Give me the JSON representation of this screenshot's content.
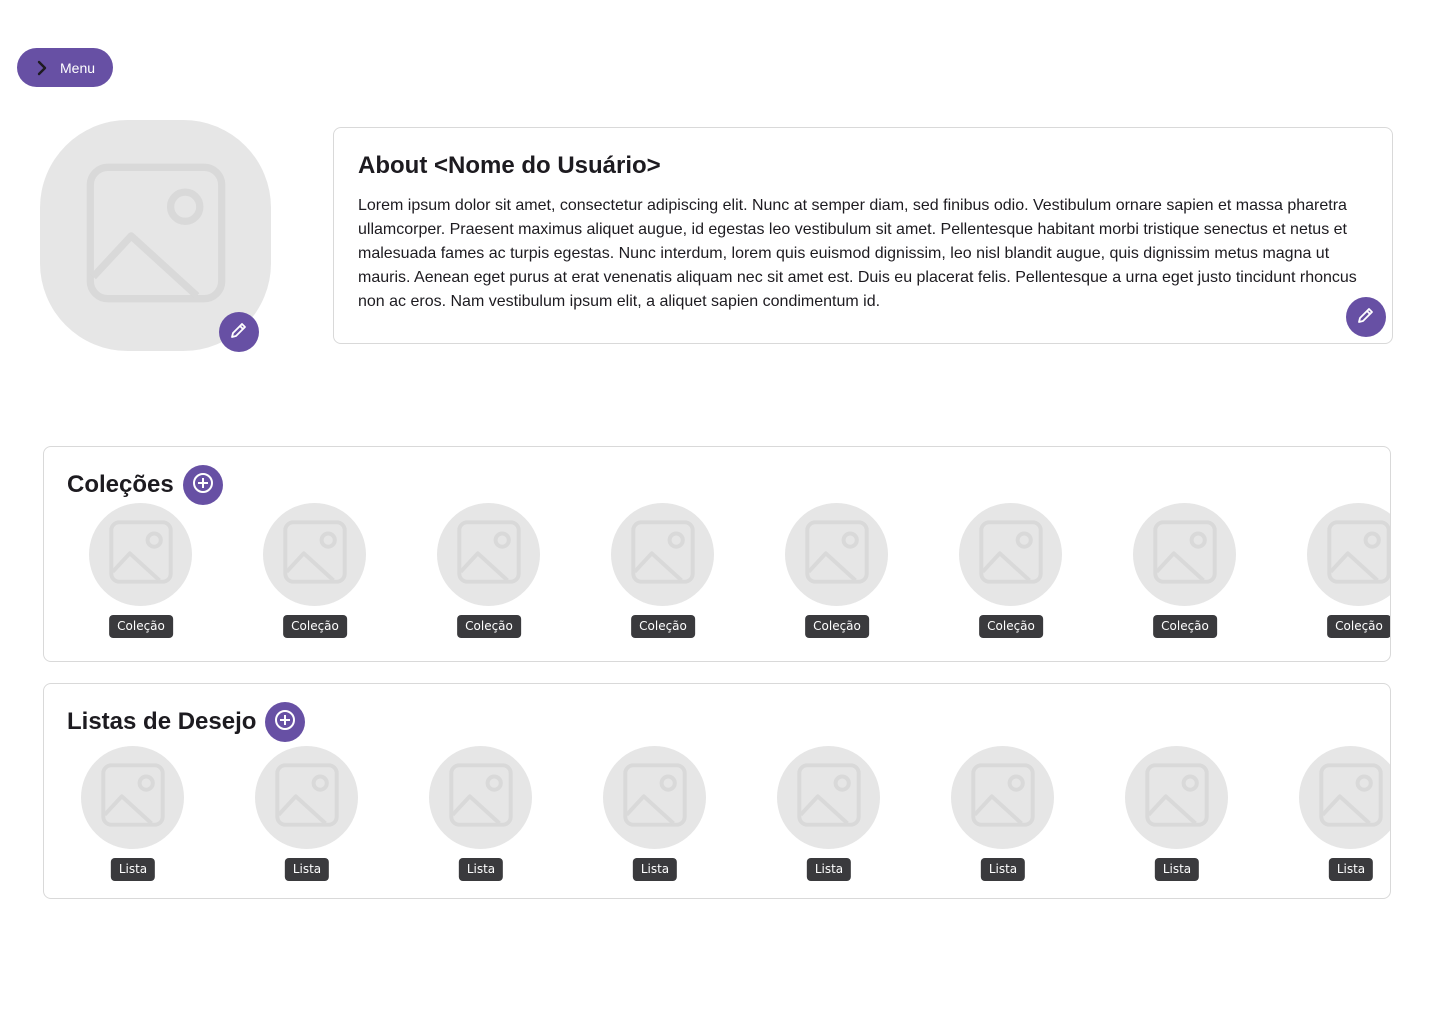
{
  "menu": {
    "label": "Menu"
  },
  "about": {
    "title": "About <Nome do Usuário>",
    "text": "Lorem ipsum dolor sit amet, consectetur adipiscing elit. Nunc at semper diam, sed finibus odio. Vestibulum ornare sapien et massa pharetra ullamcorper. Praesent maximus aliquet augue, id egestas leo vestibulum sit amet. Pellentesque habitant morbi tristique senectus et netus et malesuada fames ac turpis egestas. Nunc interdum, lorem quis euismod dignissim, leo nisl blandit augue, quis dignissim metus magna ut mauris. Aenean eget purus at erat venenatis aliquam nec sit amet est. Duis eu placerat felis. Pellentesque a urna eget justo tincidunt rhoncus non ac eros. Nam vestibulum ipsum elit, a aliquet sapien condimentum id."
  },
  "collections": {
    "title": "Coleções",
    "items": [
      {
        "label": "Coleção"
      },
      {
        "label": "Coleção"
      },
      {
        "label": "Coleção"
      },
      {
        "label": "Coleção"
      },
      {
        "label": "Coleção"
      },
      {
        "label": "Coleção"
      },
      {
        "label": "Coleção"
      },
      {
        "label": "Coleção"
      }
    ]
  },
  "wishlists": {
    "title": "Listas de Desejo",
    "items": [
      {
        "label": "Lista"
      },
      {
        "label": "Lista"
      },
      {
        "label": "Lista"
      },
      {
        "label": "Lista"
      },
      {
        "label": "Lista"
      },
      {
        "label": "Lista"
      },
      {
        "label": "Lista"
      },
      {
        "label": "Lista"
      }
    ]
  },
  "icons": {
    "menu": "chevron-right-icon",
    "edit": "pencil-icon",
    "add": "add-circle-icon",
    "placeholder": "image-placeholder-icon"
  },
  "colors": {
    "accent": "#6750a4",
    "placeholder_bg": "#e6e6e6",
    "chip_bg": "#3a3a3d"
  }
}
